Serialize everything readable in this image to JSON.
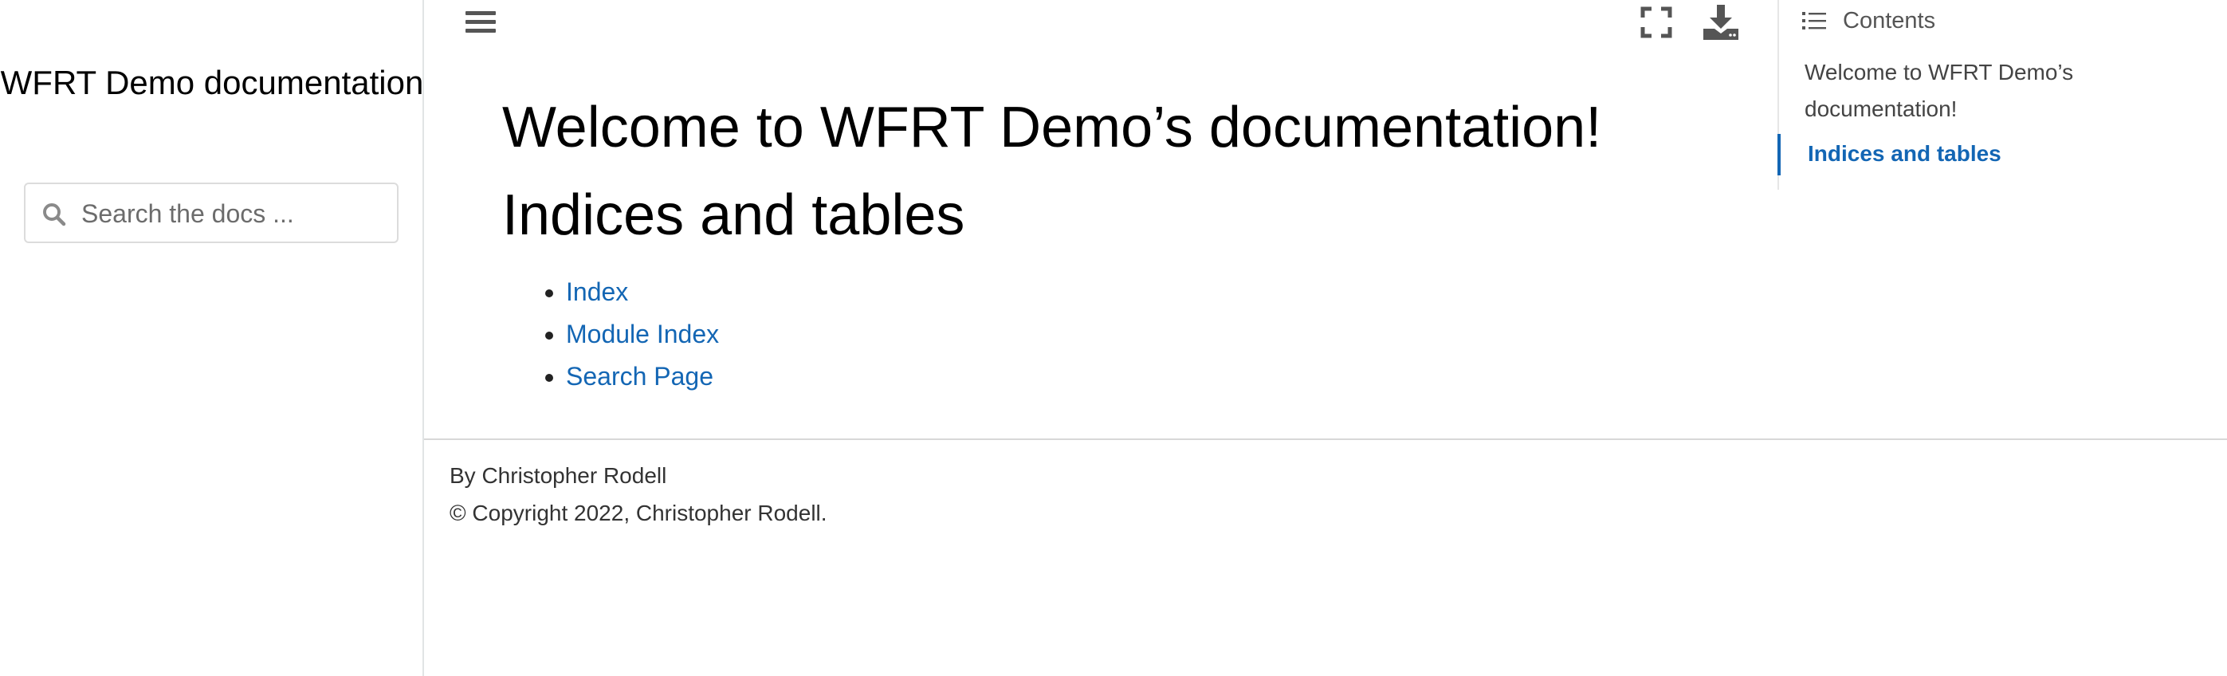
{
  "sidebar": {
    "site_title": "WFRT Demo documentation",
    "search": {
      "placeholder": "Search the docs ..."
    }
  },
  "toolbar": {
    "menu_icon": "hamburger-menu-icon",
    "fullscreen_icon": "fullscreen-icon",
    "download_icon": "download-icon"
  },
  "main": {
    "title": "Welcome to WFRT Demo’s documentation!",
    "section_heading": "Indices and tables",
    "links": [
      {
        "label": "Index"
      },
      {
        "label": "Module Index"
      },
      {
        "label": "Search Page"
      }
    ]
  },
  "footer": {
    "author": "By Christopher Rodell",
    "copyright": "© Copyright 2022, Christopher Rodell."
  },
  "toc": {
    "header": "Contents",
    "icon": "list-icon",
    "items": [
      {
        "label": "Welcome to WFRT Demo’s documentation!",
        "active": false
      },
      {
        "label": "Indices and tables",
        "active": true
      }
    ]
  },
  "colors": {
    "link": "#1366b4",
    "text": "#000000",
    "muted": "#555555",
    "border": "#e1e4e5"
  }
}
